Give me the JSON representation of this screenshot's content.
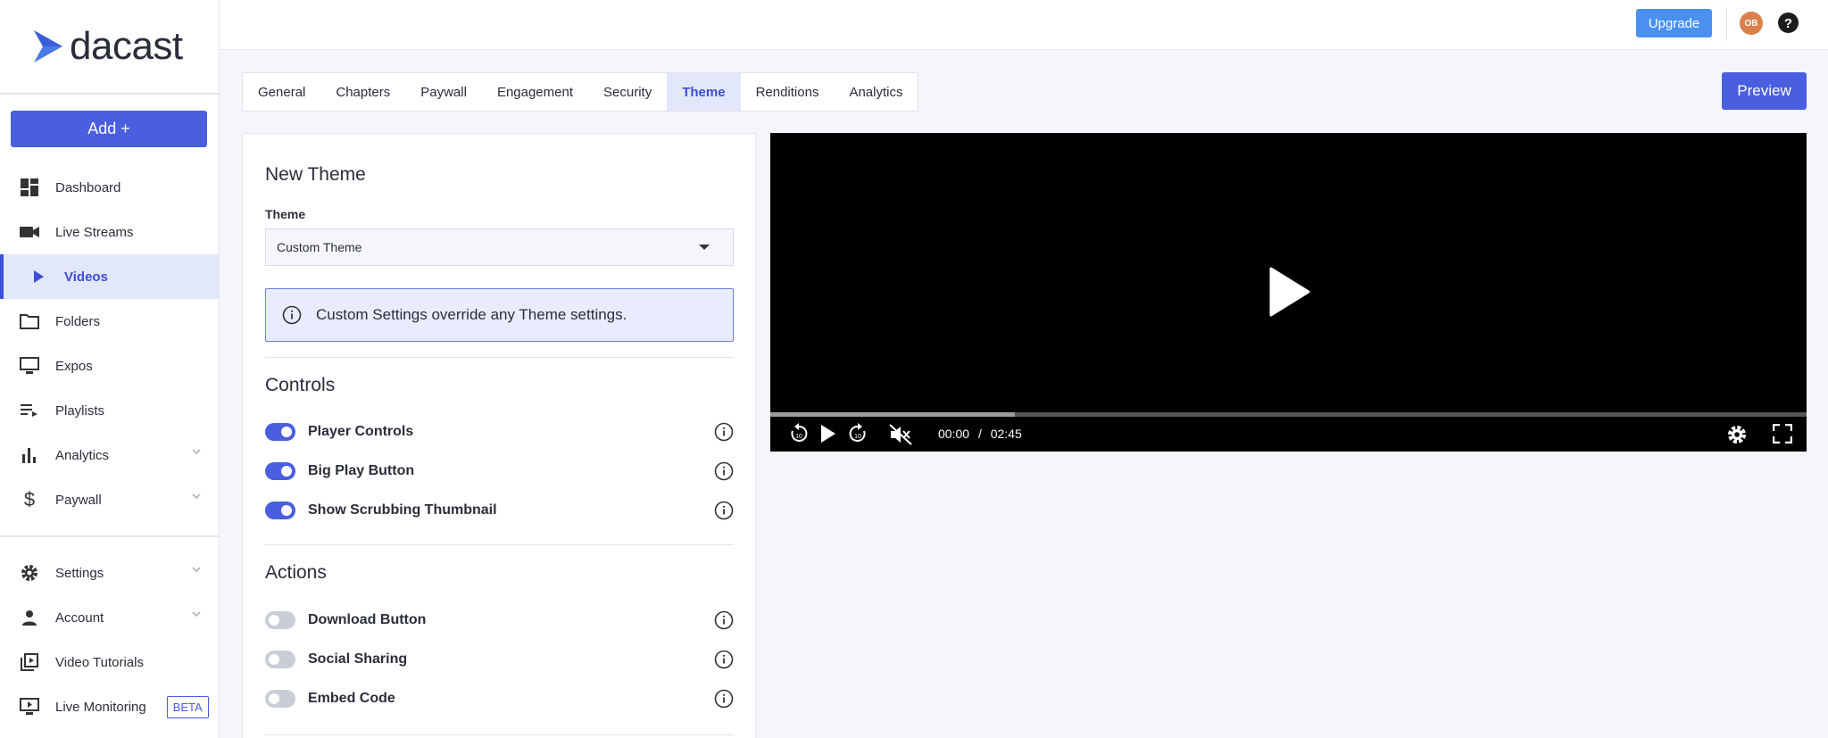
{
  "brand": {
    "name": "dacast",
    "color": "#4a5ee0"
  },
  "sidebar": {
    "add_label": "Add +",
    "items": [
      {
        "label": "Dashboard",
        "icon": "dashboard-icon"
      },
      {
        "label": "Live Streams",
        "icon": "videocam-icon"
      },
      {
        "label": "Videos",
        "icon": "play-icon"
      },
      {
        "label": "Folders",
        "icon": "folder-icon"
      },
      {
        "label": "Expos",
        "icon": "monitor-icon"
      },
      {
        "label": "Playlists",
        "icon": "playlist-icon"
      },
      {
        "label": "Analytics",
        "icon": "bar-chart-icon"
      },
      {
        "label": "Paywall",
        "icon": "dollar-icon"
      },
      {
        "label": "Settings",
        "icon": "gear-icon"
      },
      {
        "label": "Account",
        "icon": "person-icon"
      },
      {
        "label": "Video Tutorials",
        "icon": "video-library-icon"
      },
      {
        "label": "Live Monitoring",
        "icon": "monitor-play-icon",
        "badge": "BETA"
      }
    ]
  },
  "header": {
    "upgrade_label": "Upgrade",
    "avatar_initials": "OB"
  },
  "tabs": [
    "General",
    "Chapters",
    "Paywall",
    "Engagement",
    "Security",
    "Theme",
    "Renditions",
    "Analytics"
  ],
  "active_tab": "Theme",
  "preview_label": "Preview",
  "panel": {
    "title": "New Theme",
    "theme_label": "Theme",
    "theme_value": "Custom Theme",
    "info_text": "Custom Settings override any Theme settings.",
    "controls_title": "Controls",
    "controls": [
      {
        "label": "Player Controls",
        "on": true
      },
      {
        "label": "Big Play Button",
        "on": true
      },
      {
        "label": "Show Scrubbing Thumbnail",
        "on": true
      }
    ],
    "actions_title": "Actions",
    "actions": [
      {
        "label": "Download Button",
        "on": false
      },
      {
        "label": "Social Sharing",
        "on": false
      },
      {
        "label": "Embed Code",
        "on": false
      }
    ]
  },
  "player": {
    "current_time": "00:00",
    "separator": "/",
    "duration": "02:45",
    "buffered_fraction": 0.236
  }
}
